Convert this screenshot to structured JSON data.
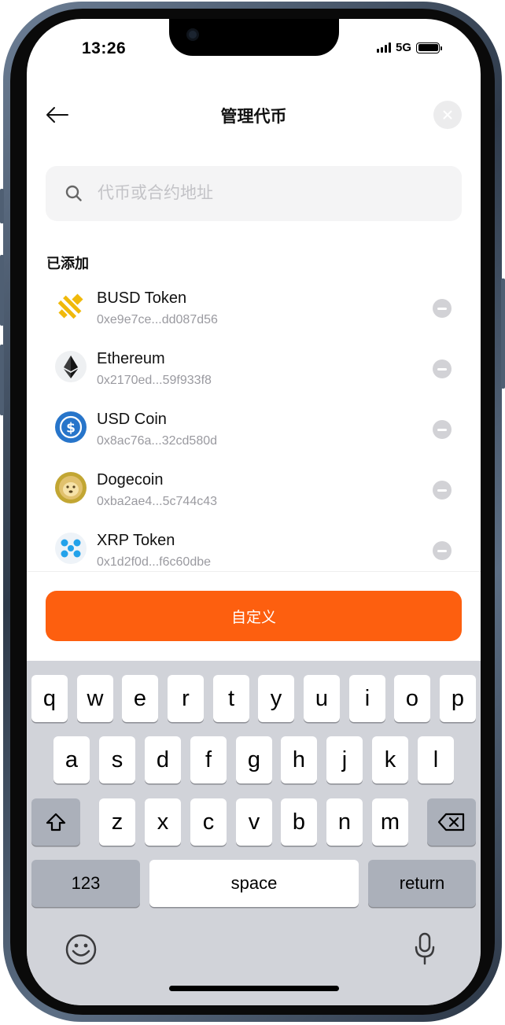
{
  "status_bar": {
    "time": "13:26",
    "network": "5G"
  },
  "header": {
    "title": "管理代币"
  },
  "search": {
    "placeholder": "代币或合约地址"
  },
  "section": {
    "added_label": "已添加"
  },
  "tokens": [
    {
      "name": "BUSD Token",
      "address": "0xe9e7ce...dd087d56",
      "icon": "busd-icon"
    },
    {
      "name": "Ethereum",
      "address": "0x2170ed...59f933f8",
      "icon": "ethereum-icon"
    },
    {
      "name": "USD Coin",
      "address": "0x8ac76a...32cd580d",
      "icon": "usdc-icon"
    },
    {
      "name": "Dogecoin",
      "address": "0xba2ae4...5c744c43",
      "icon": "dogecoin-icon"
    },
    {
      "name": "XRP Token",
      "address": "0x1d2f0d...f6c60dbe",
      "icon": "xrp-icon"
    }
  ],
  "actions": {
    "custom_label": "自定义"
  },
  "keyboard": {
    "row1": [
      "q",
      "w",
      "e",
      "r",
      "t",
      "y",
      "u",
      "i",
      "o",
      "p"
    ],
    "row2": [
      "a",
      "s",
      "d",
      "f",
      "g",
      "h",
      "j",
      "k",
      "l"
    ],
    "row3": [
      "z",
      "x",
      "c",
      "v",
      "b",
      "n",
      "m"
    ],
    "numbers_label": "123",
    "space_label": "space",
    "return_label": "return"
  },
  "colors": {
    "accent": "#fd5f0f",
    "keyboard_bg": "#d1d3d9",
    "search_bg": "#f4f4f5"
  }
}
